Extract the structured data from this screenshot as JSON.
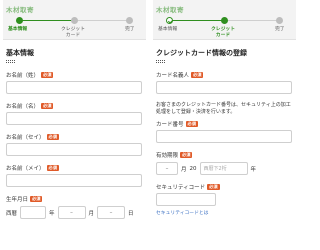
{
  "colors": {
    "accent": "#2f8f1f",
    "required_badge": "#e05a28",
    "link": "#3a6fc2"
  },
  "left": {
    "brand": "木材取寄",
    "steps": [
      {
        "label": "基本情報",
        "state": "active"
      },
      {
        "label": "クレジット\nカード",
        "state": "pending"
      },
      {
        "label": "完了",
        "state": "pending"
      }
    ],
    "progress": 0.5,
    "section_title": "基本情報",
    "required_label": "必須",
    "fields": [
      {
        "label": "お名前（姓）"
      },
      {
        "label": "お名前（名）"
      },
      {
        "label": "お名前（セイ）"
      },
      {
        "label": "お名前（メイ）"
      }
    ],
    "birthday": {
      "label": "生年月日",
      "era": "西暦",
      "separator": "–",
      "year_unit": "年",
      "month_unit": "月",
      "day_unit": "日"
    }
  },
  "right": {
    "brand": "木材取寄",
    "steps": [
      {
        "label": "基本情報",
        "state": "done"
      },
      {
        "label": "クレジット\nカード",
        "state": "active"
      },
      {
        "label": "完了",
        "state": "pending"
      }
    ],
    "progress": 0.5,
    "section_title": "クレジットカード情報の登録",
    "required_label": "必須",
    "card_holder_label": "カード名義人",
    "note": "お客さまのクレジットカード番号は、セキュリティ上の加工処理をして登録・決済を行います。",
    "card_number_label": "カード番号",
    "expiry": {
      "label": "有効期限",
      "month_value": "–",
      "month_unit": "月",
      "year_prefix": "20",
      "year_placeholder": "西暦下2桁",
      "year_unit": "年"
    },
    "security_code_label": "セキュリティコード",
    "security_link": "セキュリティコードとは"
  }
}
